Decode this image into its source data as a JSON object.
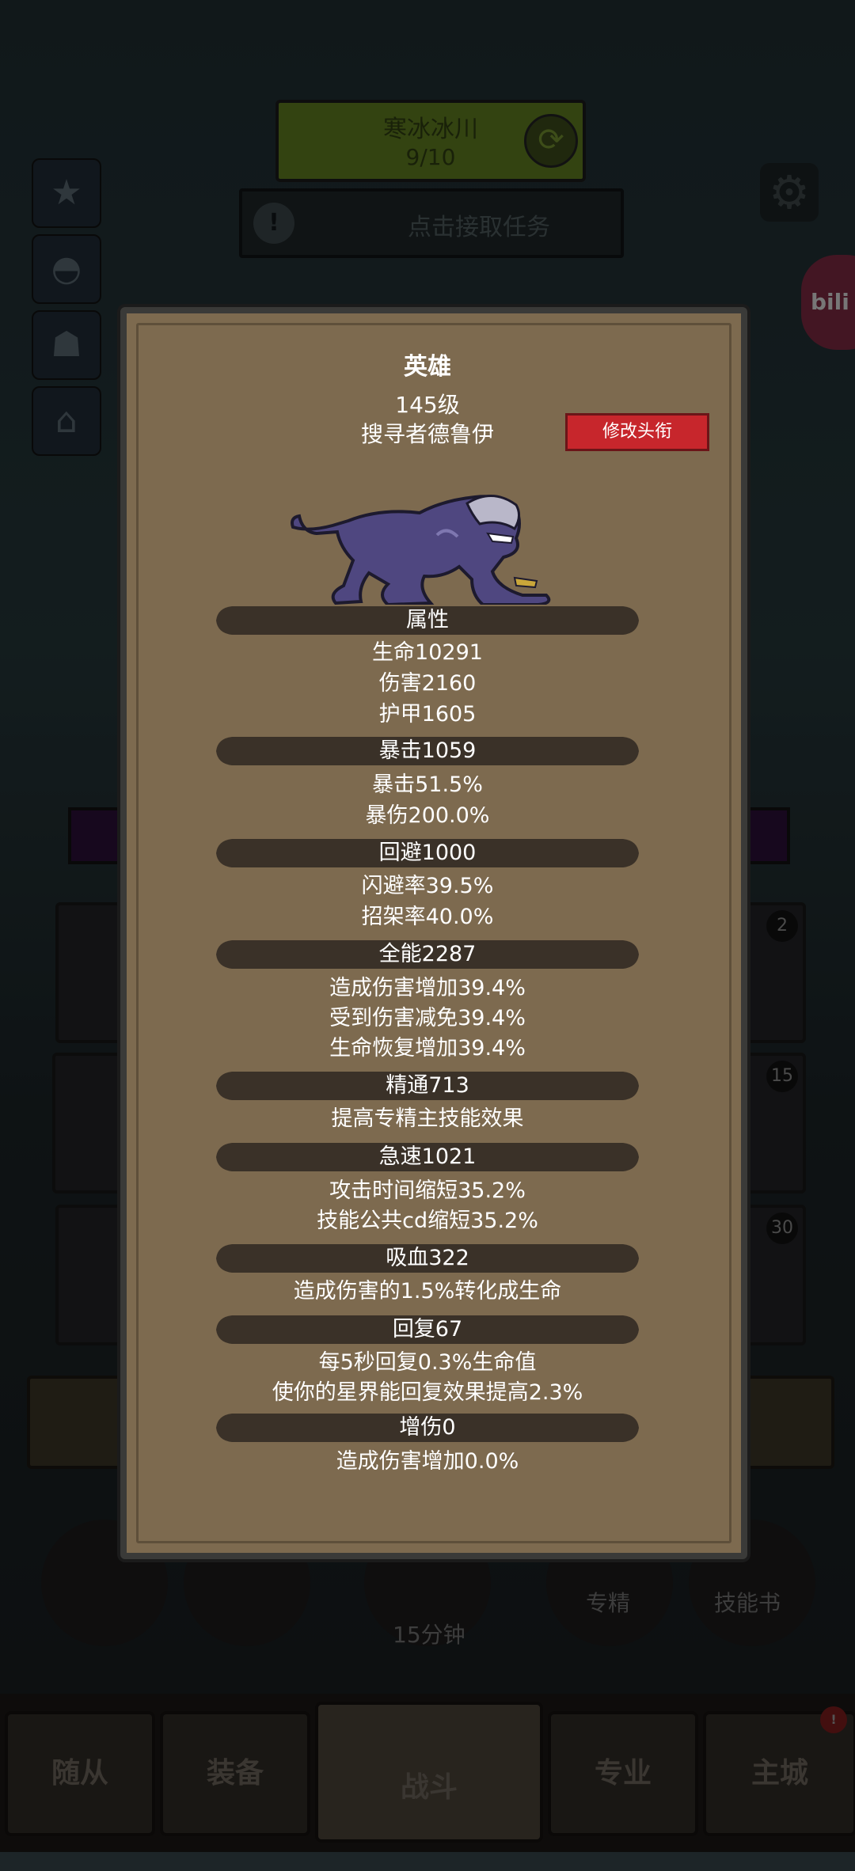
{
  "hud": {
    "zone_name": "寒冰冰川",
    "zone_progress": "9/10",
    "quest_label": "点击接取任务",
    "side_bili": "bili"
  },
  "bottom_buttons": {
    "timer_label": "15分钟",
    "spec_label": "专精",
    "skillbook_label": "技能书"
  },
  "slot_badges": [
    "2",
    "15",
    "30"
  ],
  "nav": {
    "followers": "随从",
    "equipment": "装备",
    "battle": "战斗",
    "profession": "专业",
    "main_city": "主城"
  },
  "modal": {
    "title": "英雄",
    "level": "145级",
    "hero_name": "搜寻者德鲁伊",
    "rename_button": "修改头衔",
    "sections": [
      {
        "header": "属性",
        "lines": [
          "生命10291",
          "伤害2160",
          "护甲1605"
        ]
      },
      {
        "header": "暴击1059",
        "lines": [
          "暴击51.5%",
          "暴伤200.0%"
        ]
      },
      {
        "header": "回避1000",
        "lines": [
          "闪避率39.5%",
          "招架率40.0%"
        ]
      },
      {
        "header": "全能2287",
        "lines": [
          "造成伤害增加39.4%",
          "受到伤害减免39.4%",
          "生命恢复增加39.4%"
        ]
      },
      {
        "header": "精通713",
        "lines": [
          "提高专精主技能效果"
        ]
      },
      {
        "header": "急速1021",
        "lines": [
          "攻击时间缩短35.2%",
          "技能公共cd缩短35.2%"
        ]
      },
      {
        "header": "吸血322",
        "lines": [
          "造成伤害的1.5%转化成生命"
        ]
      },
      {
        "header": "回复67",
        "lines": [
          "每5秒回复0.3%生命值",
          "使你的星界能回复效果提高2.3%"
        ]
      },
      {
        "header": "增伤0",
        "lines": [
          "造成伤害增加0.0%"
        ]
      }
    ]
  },
  "colors": {
    "modal_bg": "#7d6a4f",
    "band_dark": "#3a3128",
    "rename_red": "#c7262c",
    "text_white": "#ffffff"
  }
}
